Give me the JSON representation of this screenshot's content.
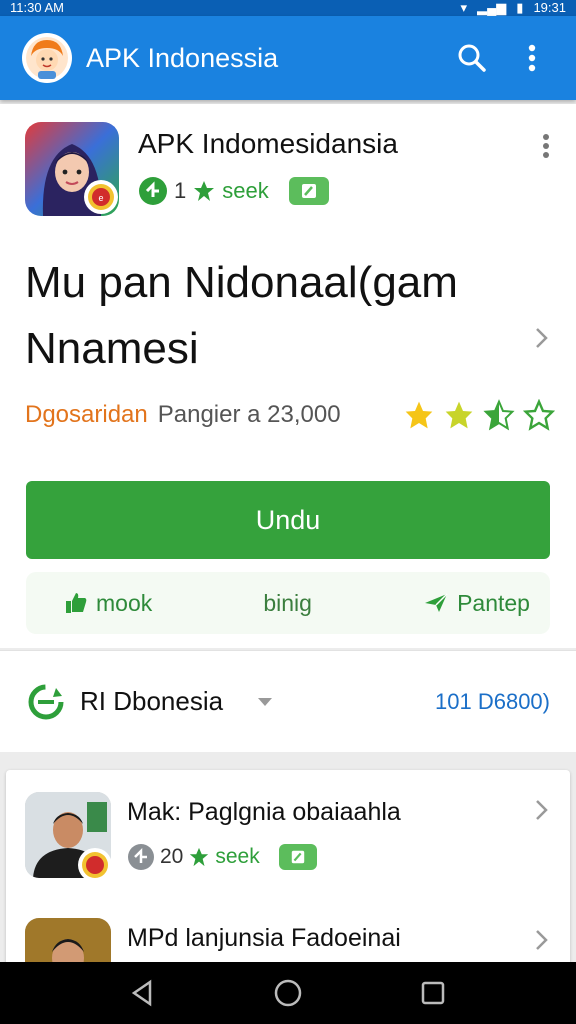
{
  "status_bar": {
    "left_text": "11:30 AM",
    "right_text": "19:31"
  },
  "app_bar": {
    "title": "APK Indonessia",
    "logo_icon": "avatar-girl-icon",
    "search_icon": "search-icon",
    "menu_icon": "more-vert-icon"
  },
  "app": {
    "name": "APK Indomesidansia",
    "meta_count": "1",
    "meta_label": "seek",
    "headline": "Mu pan Nidonaal(gam Nnamesi",
    "developer": "Dgosaridan",
    "info": "Pangier a 23,000",
    "rating": 3.5,
    "rating_max": 5
  },
  "download_label": "Undu",
  "actions": [
    {
      "label": "mook",
      "icon": "thumb-up-icon"
    },
    {
      "label": "binig",
      "icon": ""
    },
    {
      "label": "Pantep",
      "icon": "send-icon"
    }
  ],
  "region": {
    "label": "RI Dbonesia",
    "count": "101 D6800)",
    "icon": "refresh-icon"
  },
  "list": [
    {
      "title": "Mak: Paglgnia obaiaahla",
      "meta_count": "20",
      "meta_label": "seek"
    },
    {
      "title": "MPd lanjunsia Fadoeinai"
    }
  ],
  "colors": {
    "primary": "#1a82e0",
    "status_bar": "#0a5fb4",
    "accent_green": "#35a23c",
    "developer_orange": "#e2741c",
    "link_blue": "#1b6fc8",
    "star": "#f5c518"
  }
}
